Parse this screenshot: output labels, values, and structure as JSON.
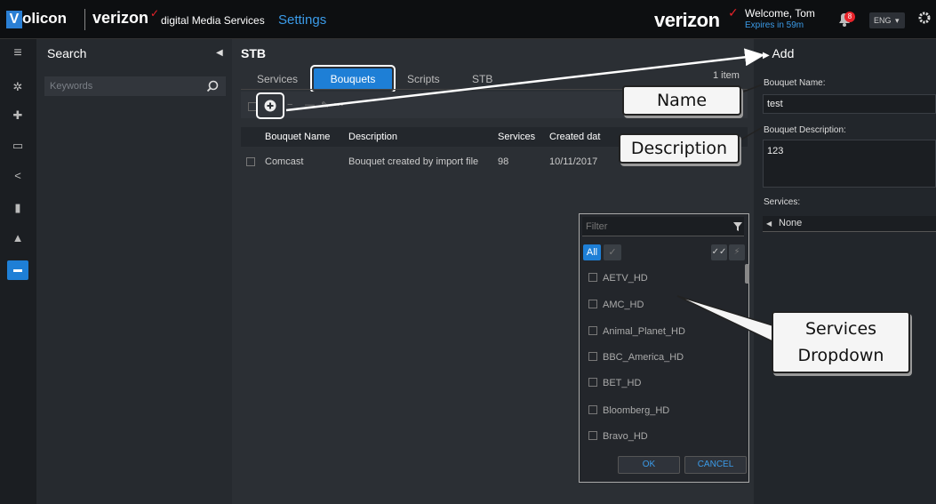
{
  "header": {
    "logo_letter": "V",
    "logo_text": "olicon",
    "brand": "verizon",
    "brand_sub": "digital Media Services",
    "page_title": "Settings",
    "brand_right": "verizon",
    "welcome": "Welcome, Tom",
    "expires": "Expires in 59m",
    "notification_count": "8",
    "language": "ENG",
    "icons": [
      "bell-icon",
      "settings-gear-icon",
      "chevron-down-icon"
    ]
  },
  "rail": {
    "icons": [
      "menu-icon",
      "gear-icon",
      "puzzle-icon",
      "monitor-icon",
      "share-icon",
      "trash-icon",
      "user-icon",
      "stb-icon"
    ]
  },
  "search": {
    "title": "Search",
    "placeholder": "Keywords"
  },
  "main": {
    "title": "STB",
    "tabs": [
      {
        "label": "Services"
      },
      {
        "label": "Bouquets"
      },
      {
        "label": "Scripts"
      },
      {
        "label": "STB"
      }
    ],
    "active_tab": "Bouquets",
    "item_count": "1 item",
    "table": {
      "headers": [
        "Bouquet Name",
        "Description",
        "Services",
        "Created dat"
      ],
      "rows": [
        [
          "Comcast",
          "Bouquet created by import file",
          "98",
          "10/11/2017"
        ]
      ]
    }
  },
  "dropdown": {
    "filter_placeholder": "Filter",
    "all_label": "All",
    "items": [
      "AETV_HD",
      "AMC_HD",
      "Animal_Planet_HD",
      "BBC_America_HD",
      "BET_HD",
      "Bloomberg_HD",
      "Bravo_HD"
    ],
    "ok_label": "OK",
    "cancel_label": "CANCEL"
  },
  "right_panel": {
    "title": "Add",
    "name_label": "Bouquet Name:",
    "name_value": "test",
    "description_label": "Bouquet Description:",
    "description_value": "123",
    "services_label": "Services:",
    "services_value": "None"
  },
  "callouts": {
    "name": "Name",
    "description": "Description",
    "services_line1": "Services",
    "services_line2": "Dropdown"
  },
  "colors": {
    "accent": "#1e7fd6",
    "accent_text": "#3b9be8",
    "background": "#262a2f",
    "header": "#0d0f11",
    "badge": "#e8232a"
  }
}
